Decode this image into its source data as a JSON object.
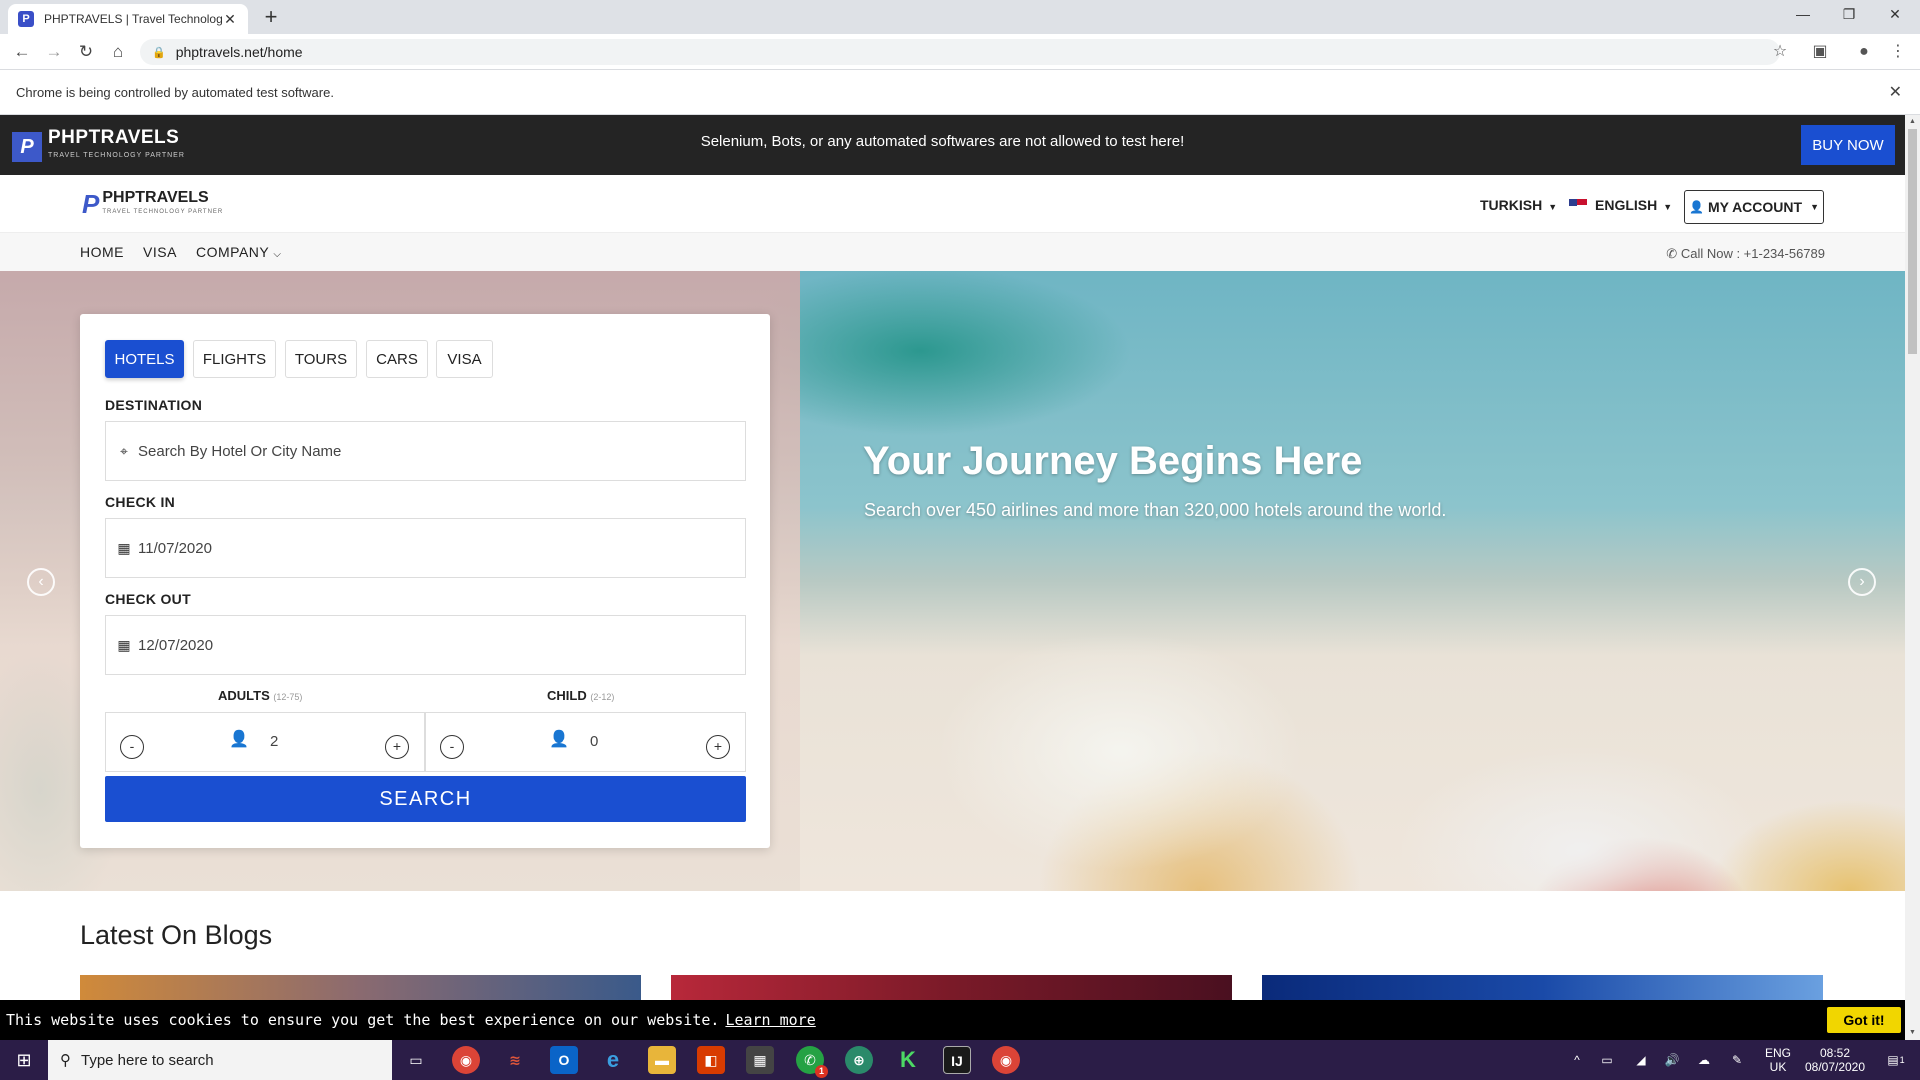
{
  "browser": {
    "tab_title": "PHPTRAVELS | Travel Technology",
    "favicon_letter": "P",
    "url": "phptravels.net/home",
    "infobar_text": "Chrome is being controlled by automated test software."
  },
  "topbar": {
    "logo": "PHPTRAVELS",
    "logo_sub": "TRAVEL TECHNOLOGY PARTNER",
    "message": "Selenium, Bots, or any automated softwares are not allowed to test here!",
    "buy_now": "BUY NOW"
  },
  "header": {
    "logo": "PHPTRAVELS",
    "logo_sub": "TRAVEL TECHNOLOGY PARTNER",
    "currency": "TURKISH",
    "language": "ENGLISH",
    "my_account": "MY ACCOUNT"
  },
  "nav": {
    "items": [
      "HOME",
      "VISA",
      "COMPANY"
    ],
    "call_now": "Call Now : +1-234-56789"
  },
  "hero": {
    "title": "Your Journey Begins Here",
    "subtitle": "Search over 450 airlines and more than 320,000 hotels around the world."
  },
  "search": {
    "tabs": [
      "HOTELS",
      "FLIGHTS",
      "TOURS",
      "CARS",
      "VISA"
    ],
    "active_tab": "HOTELS",
    "destination_label": "DESTINATION",
    "destination_placeholder": "Search By Hotel Or City Name",
    "checkin_label": "CHECK IN",
    "checkin_value": "11/07/2020",
    "checkout_label": "CHECK OUT",
    "checkout_value": "12/07/2020",
    "adults_label": "ADULTS",
    "adults_range": "(12-75)",
    "adults_value": "2",
    "child_label": "CHILD",
    "child_range": "(2-12)",
    "child_value": "0",
    "minus": "-",
    "plus": "+",
    "search_button": "SEARCH"
  },
  "blogs": {
    "title": "Latest On Blogs"
  },
  "cookie": {
    "text": "This website uses cookies to ensure you get the best experience on our website.",
    "learn_more": "Learn more",
    "got_it": "Got it!"
  },
  "taskbar": {
    "search_placeholder": "Type here to search",
    "lang_top": "ENG",
    "lang_bottom": "UK",
    "time": "08:52",
    "date": "08/07/2020",
    "whatsapp_badge": "1",
    "notification_count": "1"
  },
  "colors": {
    "accent": "#1a4fd1",
    "dark_bar": "#242424",
    "cookie_button": "#f1d600",
    "taskbar": "#2b1d47"
  }
}
